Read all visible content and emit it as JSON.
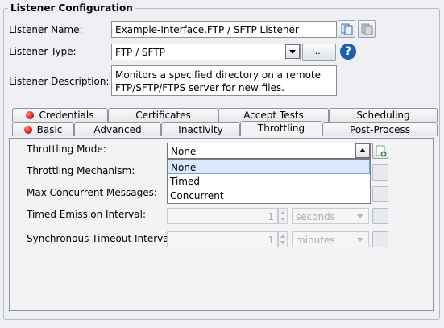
{
  "section_title": "Listener Configuration",
  "listener": {
    "name_label": "Listener Name:",
    "name_value": "Example-Interface.FTP / SFTP Listener",
    "type_label": "Listener Type:",
    "type_value": "FTP / SFTP",
    "browse_label": "...",
    "help_symbol": "?",
    "desc_label": "Listener Description:",
    "desc_line1": "Monitors a specified directory on a remote",
    "desc_line2": "FTP/SFTP/FTPS server for new files."
  },
  "tabs_row1": [
    {
      "label": "Credentials",
      "error": true
    },
    {
      "label": "Certificates",
      "error": false
    },
    {
      "label": "Accept Tests",
      "error": false
    },
    {
      "label": "Scheduling",
      "error": false
    }
  ],
  "tabs_row2": [
    {
      "label": "Basic",
      "error": true
    },
    {
      "label": "Advanced",
      "error": false
    },
    {
      "label": "Inactivity",
      "error": false
    },
    {
      "label": "Throttling",
      "error": false,
      "active": true
    },
    {
      "label": "Post-Process",
      "error": false
    }
  ],
  "throttling": {
    "mode_label": "Throttling Mode:",
    "mode_value": "None",
    "mechanism_label": "Throttling Mechanism:",
    "max_label": "Max Concurrent Messages:",
    "timed_label": "Timed Emission Interval:",
    "timed_value": "1",
    "timed_unit": "seconds",
    "sync_label": "Synchronous Timeout Interval:",
    "sync_value": "1",
    "sync_unit": "minutes",
    "options": [
      "None",
      "Timed",
      "Concurrent"
    ],
    "selected_option": "None"
  },
  "icons": {
    "copy": "copy-icon",
    "paste": "paste-icon",
    "help": "help-icon",
    "error": "error-dot-icon",
    "add": "add-icon"
  },
  "colors": {
    "accent": "#1d5fa8",
    "error": "#d81b1b",
    "selection": "#dce8fb"
  }
}
